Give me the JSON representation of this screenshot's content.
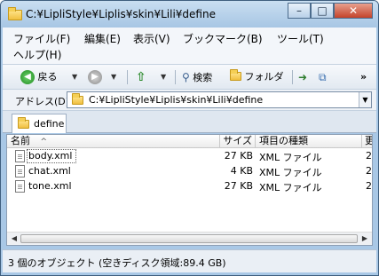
{
  "window": {
    "title": "C:¥LipliStyle¥Liplis¥skin¥Lili¥define",
    "minimize": "–",
    "maximize": "□",
    "close": "✕"
  },
  "menu": [
    {
      "label": "ファイル(F)"
    },
    {
      "label": "編集(E)"
    },
    {
      "label": "表示(V)"
    },
    {
      "label": "ブックマーク(B)"
    },
    {
      "label": "ツール(T)"
    },
    {
      "label": "ヘルプ(H)"
    }
  ],
  "toolbar": {
    "back_label": "戻る",
    "search_label": "検索",
    "folder_label": "フォルダ",
    "overflow": "»"
  },
  "address": {
    "label": "アドレス(D)",
    "path": "C:¥LipliStyle¥Liplis¥skin¥Lili¥define"
  },
  "tab": {
    "label": "define"
  },
  "list": {
    "columns": [
      "名前",
      "サイズ",
      "項目の種類",
      "更"
    ],
    "sort_indicator": "^",
    "rows": [
      {
        "name": "body.xml",
        "size": "27 KB",
        "type": "XML ファイル",
        "date": "2"
      },
      {
        "name": "chat.xml",
        "size": "4 KB",
        "type": "XML ファイル",
        "date": "2"
      },
      {
        "name": "tone.xml",
        "size": "27 KB",
        "type": "XML ファイル",
        "date": "2"
      }
    ]
  },
  "status": {
    "text": "3 個のオブジェクト (空きディスク領域:89.4 GB)"
  }
}
